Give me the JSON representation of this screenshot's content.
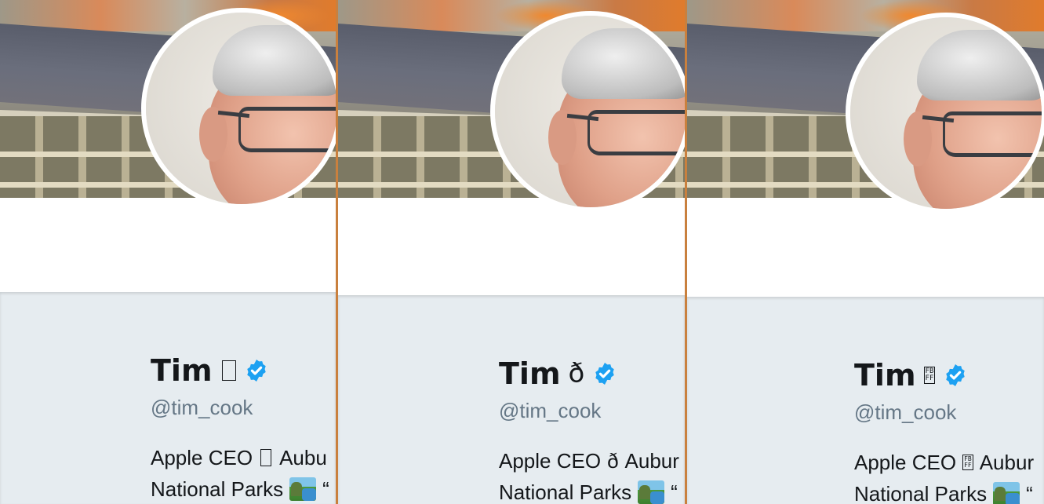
{
  "panels": [
    {
      "name_text": "Tim",
      "name_glyph_kind": "tofu-box",
      "handle": "@tim_cook",
      "bio_line1_start": "Apple CEO",
      "bio_line1_end": "Aubu",
      "bio_line2": "National Parks",
      "bio_line2_tail": "“"
    },
    {
      "name_text": "Tim",
      "name_glyph": "ð",
      "name_glyph_kind": "mojibake",
      "handle": "@tim_cook",
      "bio_line1_start": "Apple CEO",
      "bio_line1_glyph": "ð",
      "bio_line1_end": "Aubur",
      "bio_line2": "National Parks",
      "bio_line2_tail": "“"
    },
    {
      "name_text": "Tim",
      "name_glyph_kind": "hex-box",
      "name_glyph_hex": [
        "FB",
        "FF"
      ],
      "handle": "@tim_cook",
      "bio_line1_start": "Apple CEO",
      "bio_line1_end": "Aubur",
      "bio_line2": "National Parks",
      "bio_line2_tail": "“"
    }
  ],
  "icons": {
    "verified": "verified-badge-icon",
    "bio_emoji": "national-park-emoji-icon"
  },
  "colors": {
    "verified_blue": "#1da1f2",
    "handle_gray": "#657786",
    "text_dark": "#14171a",
    "info_bg": "#e6ecf0",
    "divider": "#c9803e"
  }
}
